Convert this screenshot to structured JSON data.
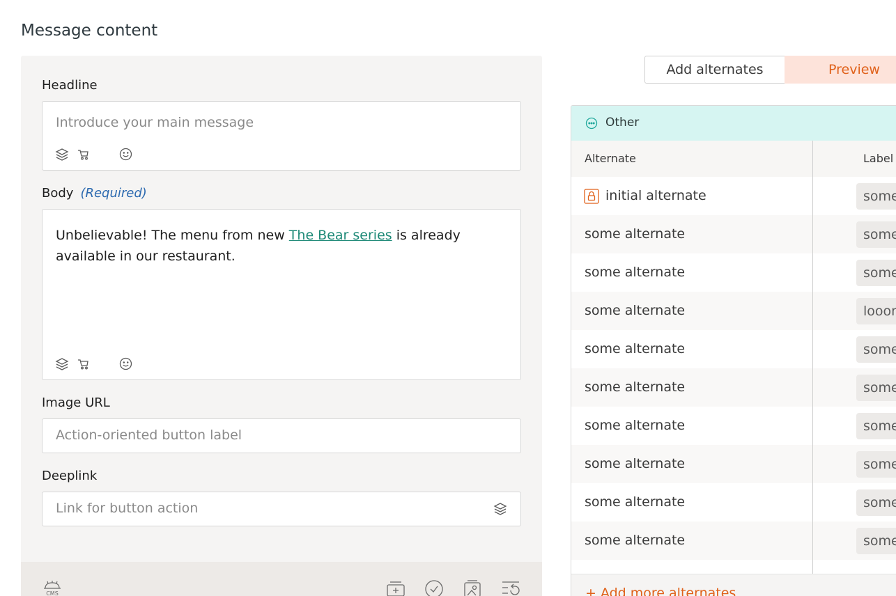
{
  "page": {
    "title": "Message content"
  },
  "form": {
    "headline": {
      "label": "Headline",
      "placeholder": "Introduce your main message"
    },
    "body": {
      "label": "Body",
      "required": "(Required)",
      "text_before": "Unbelievable! The menu from new ",
      "link_text": "The Bear series",
      "text_after": " is already available in our restaurant."
    },
    "image_url": {
      "label": "Image URL",
      "placeholder": "Action-oriented button label"
    },
    "deeplink": {
      "label": "Deeplink",
      "placeholder": "Link for button action"
    }
  },
  "toggle": {
    "add_label": "Add alternates",
    "preview_label": "Preview"
  },
  "table": {
    "group_label": "Other",
    "columns": [
      "Alternate",
      "Label"
    ],
    "rows": [
      {
        "alternate": "initial alternate",
        "label": "some",
        "locked": true
      },
      {
        "alternate": "some alternate",
        "label": "some"
      },
      {
        "alternate": "some alternate",
        "label": "some"
      },
      {
        "alternate": "some alternate",
        "label": "looon"
      },
      {
        "alternate": "some alternate",
        "label": "some"
      },
      {
        "alternate": "some alternate",
        "label": "some"
      },
      {
        "alternate": "some alternate",
        "label": "some"
      },
      {
        "alternate": "some alternate",
        "label": "some"
      },
      {
        "alternate": "some alternate",
        "label": "some"
      },
      {
        "alternate": "some alternate",
        "label": "some"
      }
    ],
    "add_more": "+ Add more alternates"
  },
  "icons": {
    "variables": "layers-icon",
    "cart": "cart-icon",
    "emoji": "smiley-icon",
    "lock": "lock-icon",
    "group": "dots-circle-icon",
    "cms": "cms-gear-icon",
    "add_card": "add-card-icon",
    "check": "check-circle-icon",
    "image": "image-card-icon",
    "reset": "reset-list-icon"
  },
  "colors": {
    "accent": "#e0621b",
    "link": "#1f8a78",
    "group_bg": "#d6f5f2",
    "required": "#2d6ab0"
  }
}
